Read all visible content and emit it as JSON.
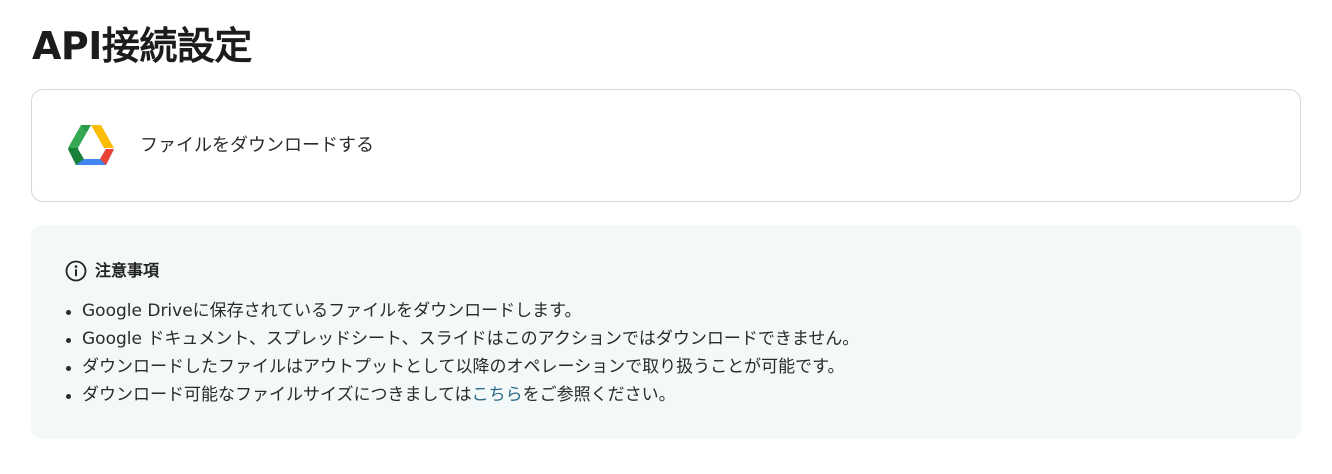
{
  "page": {
    "title": "API接続設定"
  },
  "action": {
    "icon": "google-drive-icon",
    "label": "ファイルをダウンロードする"
  },
  "notes": {
    "icon": "info-circle-icon",
    "title": "注意事項",
    "items": [
      "Google Driveに保存されているファイルをダウンロードします。",
      "Google ドキュメント、スプレッドシート、スライドはこのアクションではダウンロードできません。",
      "ダウンロードしたファイルはアウトプットとして以降のオペレーションで取り扱うことが可能です。"
    ],
    "last_item": {
      "before_link": "ダウンロード可能なファイルサイズにつきましては",
      "link_text": "こちら",
      "after_link": "をご参照ください。"
    }
  },
  "colors": {
    "link": "#2a6a86",
    "panel_background": "#f3f8f8",
    "card_border": "#d3d6da",
    "drive_green": "#34a853",
    "drive_yellow": "#fbbc04",
    "drive_blue": "#4285f4",
    "drive_dark_green": "#188038",
    "drive_red": "#ea4335"
  }
}
